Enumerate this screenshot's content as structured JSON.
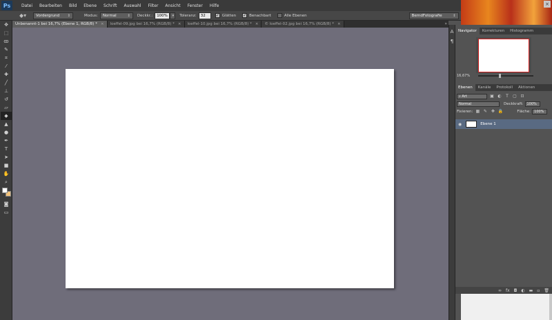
{
  "app": {
    "logo": "Ps"
  },
  "menu": [
    "Datei",
    "Bearbeiten",
    "Bild",
    "Ebene",
    "Schrift",
    "Auswahl",
    "Filter",
    "Ansicht",
    "Fenster",
    "Hilfe"
  ],
  "options": {
    "fill_source": "Vordergrund",
    "mode_label": "Modus:",
    "mode_value": "Normal",
    "opacity_label": "Deckkr.:",
    "opacity_value": "100%",
    "tolerance_label": "Toleranz:",
    "tolerance_value": "32",
    "smooth_label": "Glätten",
    "contiguous_label": "Benachbart",
    "all_layers_label": "Alle Ebenen",
    "workspace_value": "BerndFotografie"
  },
  "tabs": [
    {
      "label": "Unbenannt-1 bei 16,7% (Ebene 1, RGB/8) *",
      "close": "×"
    },
    {
      "label": "loeffel-09.jpg bei 16,7% (RGB/8) *",
      "close": "×"
    },
    {
      "label": "loeffel-10.jpg bei 16,7% (RGB/8) *",
      "close": "×"
    },
    {
      "label": "© loeffel-02.jpg bei 16,7% (RGB/8) *",
      "close": "×"
    }
  ],
  "tab_scroll": "»",
  "navigator": {
    "tabs": [
      "Navigator",
      "Korrekturen",
      "Histogramm"
    ],
    "zoom": "16,67%"
  },
  "layers_panel": {
    "tabs": [
      "Ebenen",
      "Kanäle",
      "Protokoll",
      "Aktionen"
    ],
    "filter_kind": "Art",
    "blend_mode": "Normal",
    "opacity_label": "Deckkraft:",
    "opacity_value": "100%",
    "lock_label": "Fixieren:",
    "fill_label": "Fläche:",
    "fill_value": "100%",
    "layer_name": "Ebene 1"
  },
  "colors": {
    "workspace_bg": "#6f6d7a",
    "selected_layer": "#596a82",
    "navigator_frame": "#d62020"
  }
}
